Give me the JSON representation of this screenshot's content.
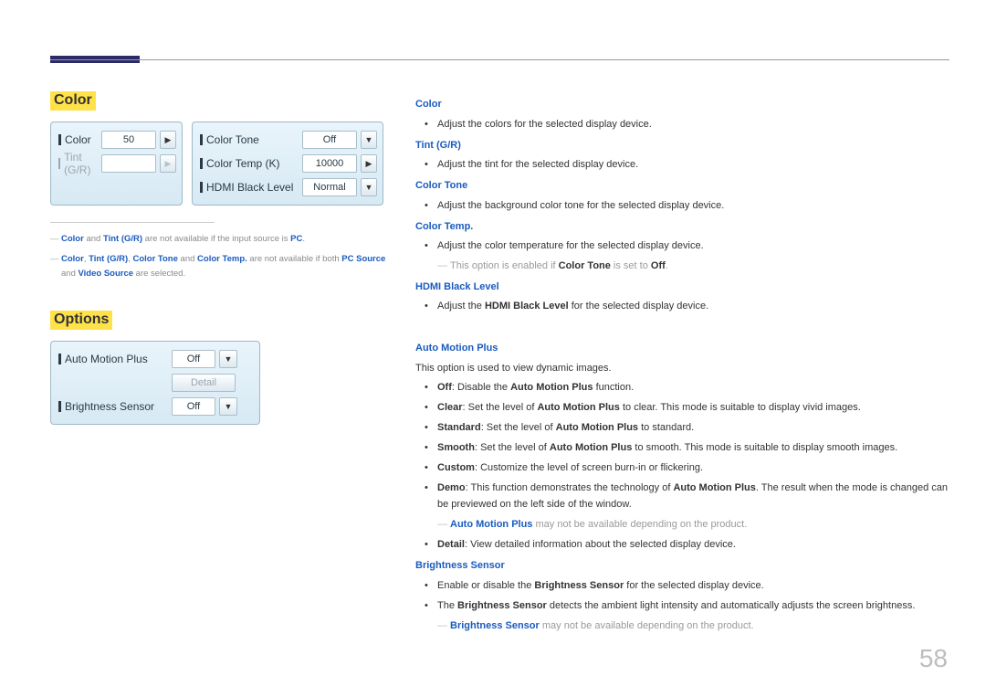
{
  "page_number": "58",
  "left": {
    "section_color": "Color",
    "section_options": "Options",
    "panel_color": {
      "color_label": "Color",
      "color_value": "50",
      "tint_label": "Tint (G/R)"
    },
    "panel_tone": {
      "tone_label": "Color Tone",
      "tone_value": "Off",
      "temp_label": "Color Temp (K)",
      "temp_value": "10000",
      "hdmi_label": "HDMI Black Level",
      "hdmi_value": "Normal"
    },
    "panel_options": {
      "amp_label": "Auto Motion Plus",
      "amp_value": "Off",
      "detail_label": "Detail",
      "bs_label": "Brightness Sensor",
      "bs_value": "Off"
    },
    "foot1": {
      "a": "Color",
      "b": " and ",
      "c": "Tint (G/R)",
      "d": " are not available if the input source is ",
      "e": "PC",
      "f": "."
    },
    "foot2": {
      "a": "Color",
      "b": ", ",
      "c": "Tint (G/R)",
      "d": ", ",
      "e": "Color Tone",
      "f": " and ",
      "g": "Color Temp.",
      "h": " are not available if both ",
      "i": "PC Source",
      "j": " and ",
      "k": "Video Source",
      "l": " are selected."
    }
  },
  "right": {
    "color_h": "Color",
    "color_li": "Adjust the colors for the selected display device.",
    "tint_h": "Tint (G/R)",
    "tint_li": "Adjust the tint for the selected display device.",
    "tone_h": "Color Tone",
    "tone_li": "Adjust the background color tone for the selected display device.",
    "temp_h": "Color Temp.",
    "temp_li": "Adjust the color temperature for the selected display device.",
    "temp_note_pre": "This option is enabled if ",
    "temp_note_b1": "Color Tone",
    "temp_note_mid": " is set to ",
    "temp_note_b2": "Off",
    "temp_note_post": ".",
    "hdmi_h": "HDMI Black Level",
    "hdmi_li_pre": "Adjust the ",
    "hdmi_li_b": "HDMI Black Level",
    "hdmi_li_post": " for the selected display device.",
    "amp_h": "Auto Motion Plus",
    "amp_intro": "This option is used to view dynamic images.",
    "amp_off_b": "Off",
    "amp_off_t1": ": Disable the ",
    "amp_off_b2": "Auto Motion Plus",
    "amp_off_t2": " function.",
    "amp_clear_b": "Clear",
    "amp_clear_t1": ": Set the level of ",
    "amp_clear_b2": "Auto Motion Plus",
    "amp_clear_t2": " to clear. This mode is suitable to display vivid images.",
    "amp_std_b": "Standard",
    "amp_std_t1": ": Set the level of ",
    "amp_std_b2": "Auto Motion Plus",
    "amp_std_t2": " to standard.",
    "amp_smooth_b": "Smooth",
    "amp_smooth_t1": ": Set the level of ",
    "amp_smooth_b2": "Auto Motion Plus",
    "amp_smooth_t2": " to smooth. This mode is suitable to display smooth images.",
    "amp_custom_b": "Custom",
    "amp_custom_t": ": Customize the level of screen burn-in or flickering.",
    "amp_demo_b": "Demo",
    "amp_demo_t1": ": This function demonstrates the technology of ",
    "amp_demo_b2": "Auto Motion Plus",
    "amp_demo_t2": ". The result when the mode is changed can be previewed on the left side of the window.",
    "amp_note_b": "Auto Motion Plus",
    "amp_note_t": " may not be available depending on the product.",
    "amp_detail_b": "Detail",
    "amp_detail_t": ": View detailed information about the selected display device.",
    "bs_h": "Brightness Sensor",
    "bs_li1_pre": "Enable or disable the ",
    "bs_li1_b": "Brightness Sensor",
    "bs_li1_post": " for the selected display device.",
    "bs_li2_pre": "The ",
    "bs_li2_b": "Brightness Sensor",
    "bs_li2_post": " detects the ambient light intensity and automatically adjusts the screen brightness.",
    "bs_note_b": "Brightness Sensor",
    "bs_note_t": " may not be available depending on the product."
  }
}
